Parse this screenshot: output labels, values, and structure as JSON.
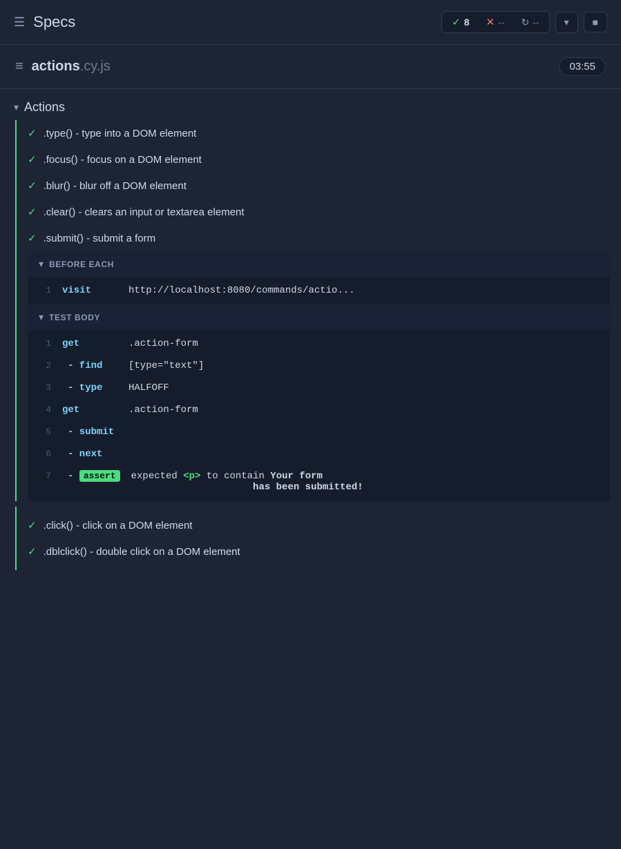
{
  "header": {
    "menu_icon": "☰",
    "title": "Specs",
    "stats": {
      "check": "✓",
      "count": "8",
      "x": "✕",
      "dash1": "--",
      "spin": "↻",
      "dash2": "--"
    },
    "btn_chevron": "▾",
    "btn_square": "▪"
  },
  "file": {
    "icon": "≡",
    "name": "actions",
    "ext": ".cy.js",
    "time": "03:55"
  },
  "suite": {
    "label": "Actions"
  },
  "tests": [
    {
      "label": ".type() - type into a DOM element"
    },
    {
      "label": ".focus() - focus on a DOM element"
    },
    {
      "label": ".blur() - blur off a DOM element"
    },
    {
      "label": ".clear() - clears an input or textarea element"
    },
    {
      "label": ".submit() - submit a form"
    }
  ],
  "before_each": {
    "title": "BEFORE EACH",
    "rows": [
      {
        "num": "1",
        "cmd": "visit",
        "arg": "http://localhost:8080/commands/actio..."
      }
    ]
  },
  "test_body": {
    "title": "TEST BODY",
    "rows": [
      {
        "num": "1",
        "cmd": "get",
        "arg": ".action-form",
        "sub": false
      },
      {
        "num": "2",
        "cmd": "- find",
        "arg": "[type=\"text\"]",
        "sub": true
      },
      {
        "num": "3",
        "cmd": "- type",
        "arg": "HALFOFF",
        "sub": true
      },
      {
        "num": "4",
        "cmd": "get",
        "arg": ".action-form",
        "sub": false
      },
      {
        "num": "5",
        "cmd": "- submit",
        "arg": "",
        "sub": true
      },
      {
        "num": "6",
        "cmd": "- next",
        "arg": "",
        "sub": true
      },
      {
        "num": "7",
        "cmd": "assert",
        "arg_parts": [
          "expected",
          "<p>",
          "to contain",
          "Your form has been submitted!"
        ],
        "sub": true,
        "is_assert": true
      }
    ]
  },
  "bottom_tests": [
    {
      "label": ".click() - click on a DOM element"
    },
    {
      "label": ".dblclick() - double click on a DOM element"
    }
  ]
}
